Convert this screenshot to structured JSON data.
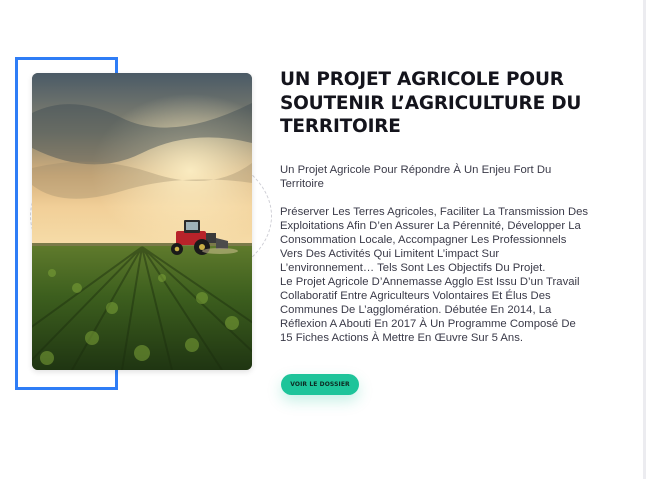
{
  "section": {
    "title": "UN PROJET AGRICOLE POUR\nSOUTENIR L’AGRICULTURE DU\nTERRITOIRE",
    "subtitle": "Un Projet Agricole Pour Répondre À Un Enjeu Fort Du\nTerritoire",
    "body": "Préserver Les Terres Agricoles, Faciliter La Transmission Des\nExploitations Afin D’en Assurer La Pérennité, Développer La\nConsommation Locale, Accompagner Les Professionnels\nVers Des Activités Qui Limitent L’impact Sur\nL’environnement… Tels Sont Les Objectifs Du Projet.\nLe Projet Agricole D’Annemasse Agglo Est Issu D’un Travail\nCollaboratif Entre Agriculteurs Volontaires Et Élus Des\nCommunes De L’agglomération. Débutée En 2014, La\nRéflexion A Abouti En 2017 À Un Programme Composé De\n15 Fiches Actions À Mettre En Œuvre Sur 5 Ans.",
    "cta_label": "VOIR LE DOSSIER"
  },
  "image": {
    "subject": "tractor-in-crop-field-at-sunset"
  },
  "colors": {
    "accent_frame": "#2f7df6",
    "button": "#1ec49a",
    "heading": "#14141c",
    "text": "#3a3a48"
  }
}
